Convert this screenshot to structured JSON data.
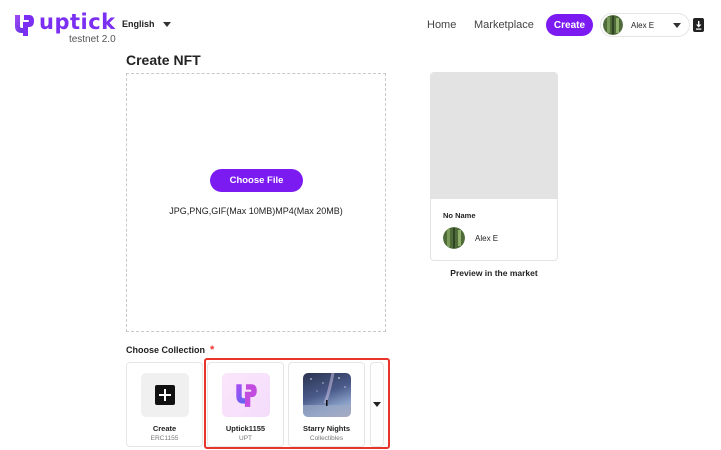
{
  "header": {
    "logo_word": "uptick",
    "logo_sub": "testnet 2.0",
    "language": "English",
    "nav": [
      {
        "label": "Home"
      },
      {
        "label": "Marketplace"
      }
    ],
    "create_label": "Create",
    "user_name": "Alex E"
  },
  "main": {
    "title": "Create NFT",
    "upload": {
      "button_label": "Choose File",
      "hint": "JPG,PNG,GIF(Max 10MB)MP4(Max 20MB)"
    },
    "preview": {
      "name": "No Name",
      "owner": "Alex E",
      "label": "Preview in the market"
    },
    "collection": {
      "label": "Choose Collection",
      "required_mark": "*",
      "items": [
        {
          "name": "Create",
          "sub": "ERC1155",
          "icon": "plus-icon"
        },
        {
          "name": "Uptick1155",
          "sub": "UPT",
          "icon": "uptick-logo"
        },
        {
          "name": "Starry Nights",
          "sub": "Collectibles",
          "icon": "starry-night-image"
        }
      ]
    }
  },
  "colors": {
    "brand": "#7b1bf2",
    "highlight": "#e8342a"
  }
}
